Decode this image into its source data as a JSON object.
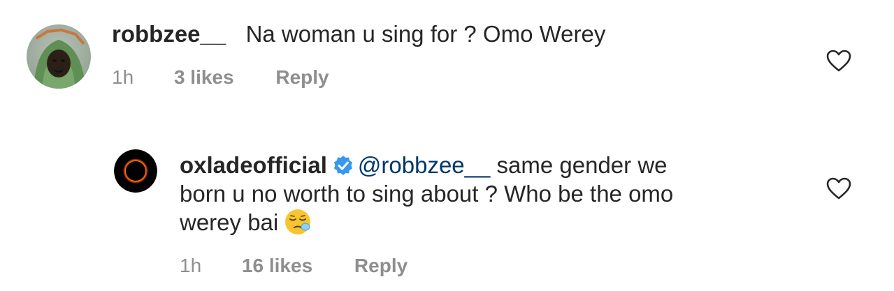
{
  "comments": [
    {
      "username": "robbzee__",
      "text": "Na woman u sing for ? Omo Werey",
      "time": "1h",
      "likes": "3 likes",
      "reply_label": "Reply",
      "avatar_icon": "profile-photo-avatar",
      "like_icon": "heart-outline-icon"
    },
    {
      "username": "oxladeofficial",
      "mention": "@robbzee__",
      "text_line1": "same gender we",
      "text_line2": "born u no worth to sing about ? Who be the omo",
      "text_line3": "werey bai",
      "time": "1h",
      "likes": "16 likes",
      "reply_label": "Reply",
      "verified_icon": "verified-badge-icon",
      "emoji_icon": "sleepy-face-emoji",
      "avatar_icon": "ring-logo-avatar",
      "like_icon": "heart-outline-icon"
    }
  ],
  "colors": {
    "text": "#262626",
    "secondary": "#8e8e8e",
    "mention": "#00376b",
    "verified": "#3897f0"
  }
}
